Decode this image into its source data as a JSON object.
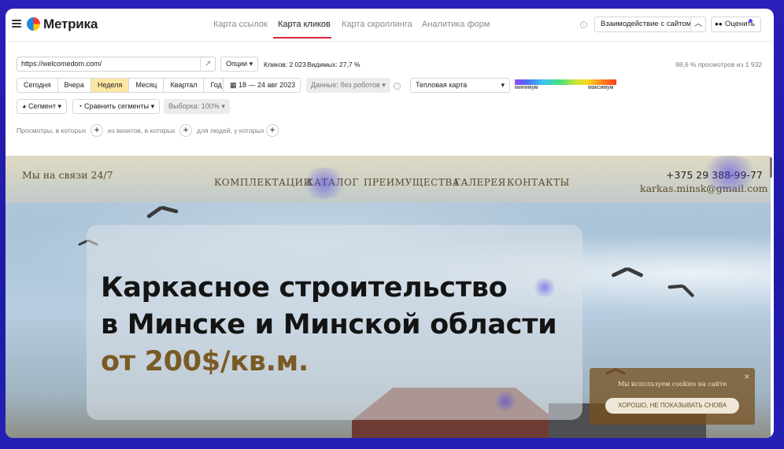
{
  "header": {
    "logo_text": "Метрика",
    "tabs": [
      {
        "label": "Карта ссылок",
        "active": false
      },
      {
        "label": "Карта кликов",
        "active": true
      },
      {
        "label": "Карта скроллинга",
        "active": false
      },
      {
        "label": "Аналитика форм",
        "active": false
      }
    ],
    "interaction_button": "Взаимодействие с сайтом",
    "rate_button": "Оценить"
  },
  "controls": {
    "url_value": "https://welcomedom.com/",
    "options_button": "Опции",
    "clicks_text": "Кликов: 2 023",
    "visible_text": "Видимых: 27,7 %",
    "views_share": "98,6 % просмотров из 1 932",
    "periods": [
      {
        "label": "Сегодня",
        "selected": false
      },
      {
        "label": "Вчера",
        "selected": false
      },
      {
        "label": "Неделя",
        "selected": true
      },
      {
        "label": "Месяц",
        "selected": false
      },
      {
        "label": "Квартал",
        "selected": false
      },
      {
        "label": "Год",
        "selected": false
      }
    ],
    "date_range": "18 — 24 авг 2023",
    "data_filter": "Данные: без роботов",
    "map_type": "Тепловая карта",
    "legend_min": "минимум",
    "legend_max": "максимум",
    "segment_button": "Сегмент",
    "compare_button": "Сравнить сегменты",
    "sample_button": "Выборка: 100%",
    "filter_views": "Просмотры, в которых",
    "filter_visits": "из визитов, в которых",
    "filter_people": "для людей, у которых"
  },
  "site": {
    "contact": "Мы на связи 24/7",
    "nav": [
      "КОМПЛЕКТАЦИИ",
      "КАТАЛОГ",
      "ПРЕИМУЩЕСТВА",
      "ГАЛЕРЕЯ",
      "КОНТАКТЫ"
    ],
    "phone": "+375 29 388-99-77",
    "email": "karkas.minsk@gmail.com",
    "hero_line1": "Каркасное строительство",
    "hero_line2": "в Минске и Минской области",
    "hero_line3": "от 200$/кв.м.",
    "cookie_text": "Мы используем cookies на сайте",
    "cookie_button": "ХОРОШО, НЕ ПОКАЗЫВАТЬ СНОВА"
  },
  "colors": {
    "accent_red": "#d9263a",
    "selected_period": "#fde6a4",
    "background_blue": "#2a1fb8",
    "hero_price": "#7a5a25"
  }
}
